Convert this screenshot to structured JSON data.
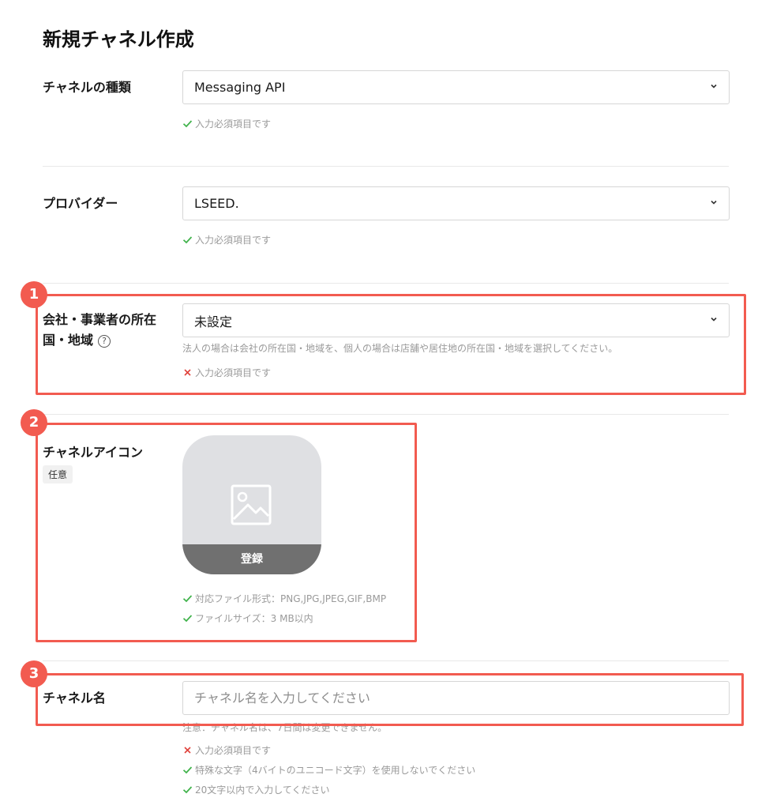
{
  "page": {
    "title": "新規チャネル作成"
  },
  "colors": {
    "accent": "#f25b50",
    "valid": "#3fb24a",
    "invalid": "#e0423b"
  },
  "channel_type": {
    "label": "チャネルの種類",
    "value": "Messaging API",
    "hint": "入力必須項目です"
  },
  "provider": {
    "label": "プロバイダー",
    "value": "LSEED.",
    "hint": "入力必須項目です"
  },
  "region": {
    "label_line1": "会社・事業者の所在",
    "label_line2": "国・地域",
    "help_icon": "?",
    "value": "未設定",
    "description": "法人の場合は会社の所在国・地域を、個人の場合は店舗や居住地の所在国・地域を選択してください。",
    "error": "入力必須項目です"
  },
  "channel_icon": {
    "label": "チャネルアイコン",
    "optional_badge": "任意",
    "register_label": "登録",
    "hints": [
      "対応ファイル形式：PNG,JPG,JPEG,GIF,BMP",
      "ファイルサイズ：3 MB以内"
    ]
  },
  "channel_name": {
    "label": "チャネル名",
    "placeholder": "チャネル名を入力してください",
    "note": "注意：チャネル名は、7日間は変更できません。",
    "error": "入力必須項目です",
    "hints": [
      "特殊な文字（4バイトのユニコード文字）を使用しないでください",
      "20文字以内で入力してください"
    ]
  },
  "callouts": [
    "1",
    "2",
    "3"
  ]
}
